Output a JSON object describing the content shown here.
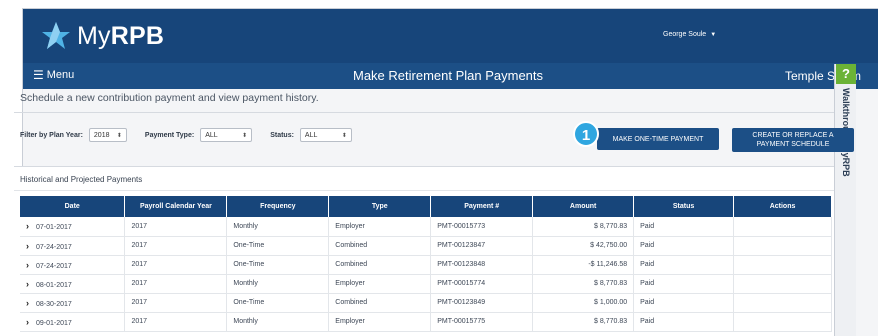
{
  "app": {
    "logo_text_light": "My",
    "logo_text_bold": "RPB",
    "user_name": "George Soule"
  },
  "nav": {
    "menu_label": "Menu",
    "page_title": "Make Retirement Plan Payments",
    "organization": "Temple Solom"
  },
  "walkthrough": {
    "help_label": "?",
    "label": "Walkthrough MyRPB"
  },
  "page": {
    "subtitle": "Schedule a new contribution payment and view payment history."
  },
  "filters": {
    "plan_year_label": "Filter by Plan Year:",
    "plan_year_value": "2018",
    "payment_type_label": "Payment Type:",
    "payment_type_value": "ALL",
    "status_label": "Status:",
    "status_value": "ALL"
  },
  "actions": {
    "step_badge": "1",
    "one_time_label": "MAKE ONE-TIME PAYMENT",
    "schedule_label": "CREATE OR REPLACE A PAYMENT SCHEDULE"
  },
  "history": {
    "title": "Historical and Projected Payments",
    "columns": [
      "Date",
      "Payroll Calendar Year",
      "Frequency",
      "Type",
      "Payment #",
      "Amount",
      "Status",
      "Actions"
    ],
    "rows": [
      {
        "date": "07-01-2017",
        "year": "2017",
        "frequency": "Monthly",
        "type": "Employer",
        "payment": "PMT-00015773",
        "amount": "$ 8,770.83",
        "status": "Paid",
        "actions": ""
      },
      {
        "date": "07-24-2017",
        "year": "2017",
        "frequency": "One-Time",
        "type": "Combined",
        "payment": "PMT-00123847",
        "amount": "$ 42,750.00",
        "status": "Paid",
        "actions": ""
      },
      {
        "date": "07-24-2017",
        "year": "2017",
        "frequency": "One-Time",
        "type": "Combined",
        "payment": "PMT-00123848",
        "amount": "-$ 11,246.58",
        "status": "Paid",
        "actions": ""
      },
      {
        "date": "08-01-2017",
        "year": "2017",
        "frequency": "Monthly",
        "type": "Employer",
        "payment": "PMT-00015774",
        "amount": "$ 8,770.83",
        "status": "Paid",
        "actions": ""
      },
      {
        "date": "08-30-2017",
        "year": "2017",
        "frequency": "One-Time",
        "type": "Combined",
        "payment": "PMT-00123849",
        "amount": "$ 1,000.00",
        "status": "Paid",
        "actions": ""
      },
      {
        "date": "09-01-2017",
        "year": "2017",
        "frequency": "Monthly",
        "type": "Employer",
        "payment": "PMT-00015775",
        "amount": "$ 8,770.83",
        "status": "Paid",
        "actions": ""
      }
    ]
  },
  "colors": {
    "header_blue": "#17457a",
    "nav_blue": "#1c4f86",
    "accent_cyan": "#2fa6e0",
    "help_green": "#6bb336"
  },
  "icons": {
    "logo": "star-logo-icon",
    "menu": "hamburger-icon",
    "user_caret": "caret-down-icon",
    "row_expand": "chevron-right-icon",
    "select_arrow": "up-down-arrows-icon"
  }
}
